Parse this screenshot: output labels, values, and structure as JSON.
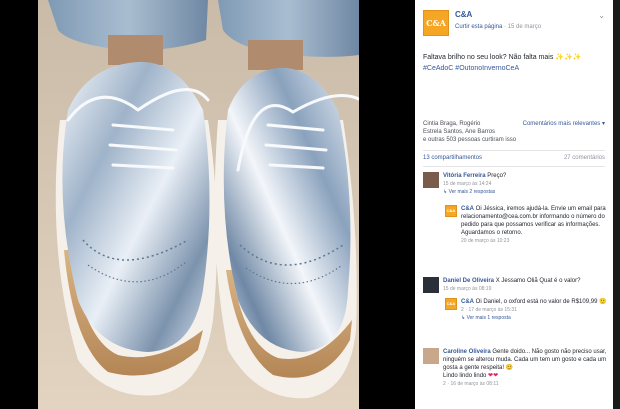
{
  "page": {
    "name": "C&A",
    "logo_text": "C&A",
    "follow_label": "Curtir esta página",
    "date": "15 de março",
    "menu_icon": "chevron-down-icon"
  },
  "post": {
    "text": "Faltava brilho no seu look? Não falta mais",
    "stars": "✨✨✨",
    "tags": "#CeAdoC #OutonoInvernoCeA"
  },
  "reactions": {
    "names_line1": "Cintia Braga, Rogério",
    "names_line2": "Estrela Santos, Ane Barros",
    "names_line3": "e outras 503 pessoas curtiram isso",
    "relevance": "Comentários mais relevantes ▾",
    "shares": "13 compartilhamentos",
    "comments_count": "27 comentários"
  },
  "comments": [
    {
      "name": "Vitória Ferreira",
      "text": "Preço?",
      "time": "15 de março às 14:24",
      "replies": "↳ Ver mais 2 respostas"
    },
    {
      "name": "C&A",
      "text": "Oi Jéssica, iremos ajudá-la. Envie um email para relacionamento@cea.com.br informando o número do pedido para que possamos verificar as informações. Aguardamos o retorno.",
      "time": "20 de março às 10:23"
    },
    {
      "name": "Daniel De Oliveira",
      "text": "X Jessamo Oliã Quat é o valor?",
      "time": "15 de março às 08:19"
    },
    {
      "name": "C&A",
      "text": "Oi Daniel, o oxford está no valor de R$109,99",
      "emoji": "🙂",
      "likes": "2",
      "time": "17 de março às 15:31",
      "replies": "↳ Ver mais 1 resposta"
    },
    {
      "name": "Caroline Oliveira",
      "text": "Gente doido... Não gosto não preciso usar, ninguém se alterou muda. Cada um tem um gosto e cada um gosta a gente respeita!",
      "emoji": "🙂",
      "extra": "Lindo lindo lindo",
      "hearts": "❤❤",
      "likes": "2",
      "time": "16 de março às 08:11"
    }
  ],
  "colors": {
    "link": "#365899",
    "brand": "#f5a623",
    "meta": "#90949c"
  }
}
